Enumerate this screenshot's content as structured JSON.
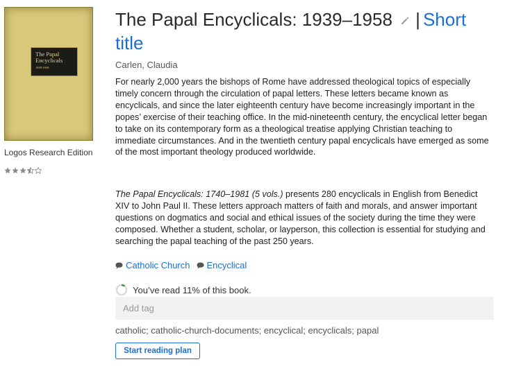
{
  "book": {
    "cover": {
      "line1": "The Papal",
      "line2": "Encyclicals",
      "dates": "1939-1958"
    },
    "edition": "Logos Research Edition",
    "rating": {
      "filled": 3,
      "half": 1,
      "max": 5
    },
    "title": "The Papal Encyclicals: 1939–1958",
    "separator": "|",
    "short_title_link": "Short title",
    "author": "Carlen, Claudia",
    "description_1": "For nearly 2,000 years the bishops of Rome have addressed theological topics of especially timely concern through the circulation of papal letters. These letters became known as encyclicals, and since the later eighteenth century have become increasingly important in the popes’ exercise of their teaching office. In the mid-nineteenth century, the encyclical letter began to take on its contemporary form as a theological treatise applying Christian teaching to immediate circumstances. And in the twentieth century papal encyclicals have emerged as some of the most important theology produced worldwide.",
    "description_2_italic": "The Papal Encyclicals: 1740–1981 (5 vols.)",
    "description_2_rest": " presents 280 encyclicals in English from Benedict XIV to John Paul II. These letters approach matters of faith and morals, and answer important questions on dogmatics and social and ethical issues of the society during the time they were composed. Whether a student, scholar, or layperson, this collection is essential for studying and searching the papal teaching of the past 250 years.",
    "categories": [
      "Catholic Church",
      "Encyclical"
    ],
    "progress_text": "You’ve read 11% of this book.",
    "progress_fraction": 0.11,
    "tag_placeholder": "Add tag",
    "tags": "catholic; catholic-church-documents; encyclical; encyclicals; papal",
    "reading_plan_button": "Start reading plan"
  },
  "colors": {
    "link": "#1a6ed8",
    "star": "#8a8a8a",
    "cover": "#d9c97a"
  },
  "icons": {
    "edit": "pencil-icon",
    "category": "speech-bubble-icon",
    "progress": "progress-ring-icon"
  }
}
